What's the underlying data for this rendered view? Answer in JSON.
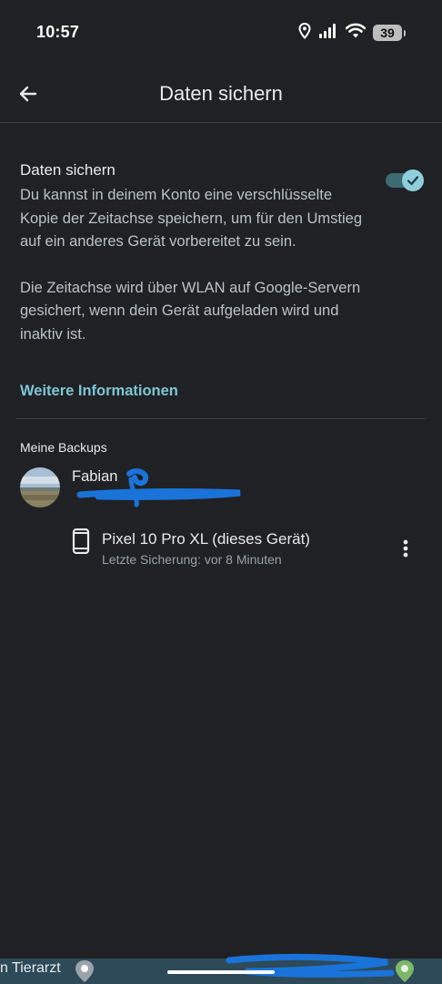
{
  "status_bar": {
    "time": "10:57",
    "battery": "39"
  },
  "app_bar": {
    "title": "Daten sichern"
  },
  "backup_section": {
    "heading": "Daten sichern",
    "description_1": "Du kannst in deinem Konto eine verschlüsselte Kopie der Zeitachse speichern, um für den Umstieg auf ein anderes Gerät vorbereitet zu sein.",
    "description_2": "Die Zeitachse wird über WLAN auf Google-Servern gesichert, wenn dein Gerät aufgeladen wird und inaktiv ist.",
    "toggle_on": true,
    "more_info_link": "Weitere Informationen"
  },
  "backups": {
    "subheader": "Meine Backups",
    "account_name": "Fabian",
    "device": {
      "name": "Pixel 10 Pro XL (dieses Gerät)",
      "last_backup": "Letzte Sicherung: vor 8 Minuten"
    }
  },
  "background_map": {
    "label": "n Tierarzt"
  },
  "colors": {
    "background": "#202124",
    "accent": "#7cc7d6",
    "toggle_thumb": "#8fcfdb",
    "toggle_track": "#3d6a73",
    "redaction": "#1a73d9"
  },
  "icons": {
    "back": "arrow-back-icon",
    "location": "location-icon",
    "signal": "signal-icon",
    "wifi": "wifi-icon",
    "battery": "battery-icon",
    "check": "check-icon",
    "phone": "smartphone-icon",
    "more": "more-vert-icon"
  }
}
